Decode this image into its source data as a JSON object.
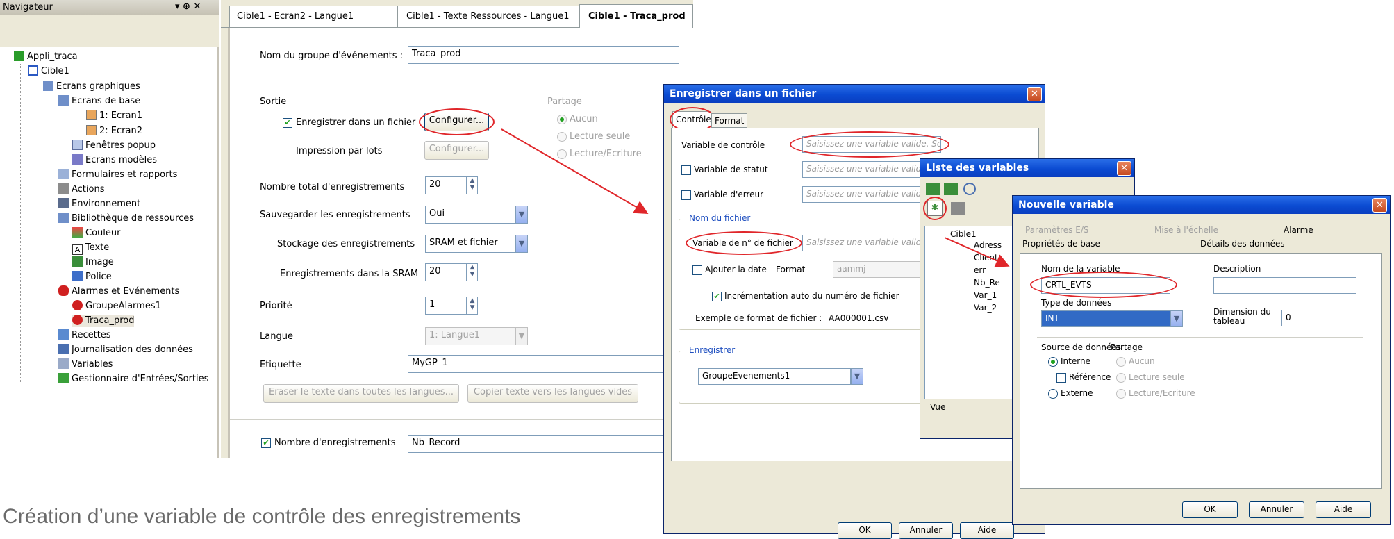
{
  "navigator": {
    "title": "Navigateur",
    "pin": "▾ ⊕ ✕",
    "tree": [
      "Appli_traca",
      "Cible1",
      "Ecrans graphiques",
      "Ecrans de base",
      "1: Ecran1",
      "2: Ecran2",
      "Fenêtres popup",
      "Ecrans modèles",
      "Formulaires et rapports",
      "Actions",
      "Environnement",
      "Bibliothèque de ressources",
      "Couleur",
      "Texte",
      "Image",
      "Police",
      "Alarmes et Evénements",
      "GroupeAlarmes1",
      "Traca_prod",
      "Recettes",
      "Journalisation des données",
      "Variables",
      "Gestionnaire d'Entrées/Sorties"
    ]
  },
  "tabs": [
    "Cible1 - Ecran2 - Langue1",
    "Cible1 - Texte Ressources - Langue1",
    "Cible1 - Traca_prod"
  ],
  "editor": {
    "group_name_label": "Nom du groupe d'événements :",
    "group_name_value": "Traca_prod",
    "output_label": "Sortie",
    "share_label": "Partage",
    "save_file_label": "Enregistrer dans un fichier",
    "configure_btn": "Configurer...",
    "batch_print_label": "Impression par lots",
    "configure_btn2": "Configurer...",
    "share_opts": [
      "Aucun",
      "Lecture seule",
      "Lecture/Ecriture"
    ],
    "total_label": "Nombre total d'enregistrements",
    "total_value": "20",
    "save_records_label": "Sauvegarder les enregistrements",
    "save_records_value": "Oui",
    "storage_label": "Stockage des enregistrements",
    "storage_value": "SRAM et fichier",
    "sram_label": "Enregistrements dans la SRAM",
    "sram_value": "20",
    "priority_label": "Priorité",
    "priority_value": "1",
    "lang_label": "Langue",
    "lang_value": "1: Langue1",
    "tag_label": "Etiquette",
    "tag_value": "MyGP_1",
    "erase_btn": "Eraser le texte dans toutes les langues...",
    "copy_btn": "Copier texte vers les langues vides",
    "count_label": "Nombre d'enregistrements",
    "count_value": "Nb_Record"
  },
  "dlg1": {
    "title": "Enregistrer dans un fichier",
    "tabs": [
      "Contrôle",
      "Format"
    ],
    "ctrl_var_label": "Variable de contrôle",
    "placeholder": "Saisissez une variable valide. So",
    "status_var_label": "Variable de statut",
    "error_var_label": "Variable d'erreur",
    "placeholder_short": "Saisissez une variable valide",
    "filename_group": "Nom du fichier",
    "file_no_label": "Variable de n° de fichier",
    "add_date_label": "Ajouter la date",
    "format_label": "Format",
    "format_value": "aammj",
    "auto_inc_label": "Incrémentation auto du numéro de fichier",
    "example_label": "Exemple de format de fichier :",
    "example_value": "AA000001.csv",
    "save_group": "Enregistrer",
    "save_value": "GroupeEvenements1",
    "ok": "OK",
    "cancel": "Annuler",
    "help": "Aide"
  },
  "dlg2": {
    "title": "Liste des variables",
    "tree": [
      "Cible1",
      "Adress",
      "Client",
      "err",
      "Nb_Re",
      "Var_1",
      "Var_2"
    ],
    "tab": "Vue"
  },
  "dlg3": {
    "title": "Nouvelle variable",
    "tabs": [
      "Paramètres E/S",
      "Mise à l'échelle",
      "Alarme"
    ],
    "subtabs": [
      "Propriétés de base",
      "Détails des données"
    ],
    "name_label": "Nom de la variable",
    "name_value": "CRTL_EVTS",
    "desc_label": "Description",
    "type_label": "Type de données",
    "type_value": "INT",
    "dim_label": "Dimension du tableau",
    "dim_value": "0",
    "source_label": "Source de données",
    "share_label": "Partage",
    "src_opts": [
      "Interne",
      "Référence",
      "Externe"
    ],
    "share_opts": [
      "Aucun",
      "Lecture seule",
      "Lecture/Ecriture"
    ],
    "ok": "OK",
    "cancel": "Annuler",
    "help": "Aide"
  },
  "caption": "Création d’une variable de contrôle des enregistrements",
  "colors": {
    "accent": "#e0262a",
    "titlebar": "#0b4bd2"
  }
}
